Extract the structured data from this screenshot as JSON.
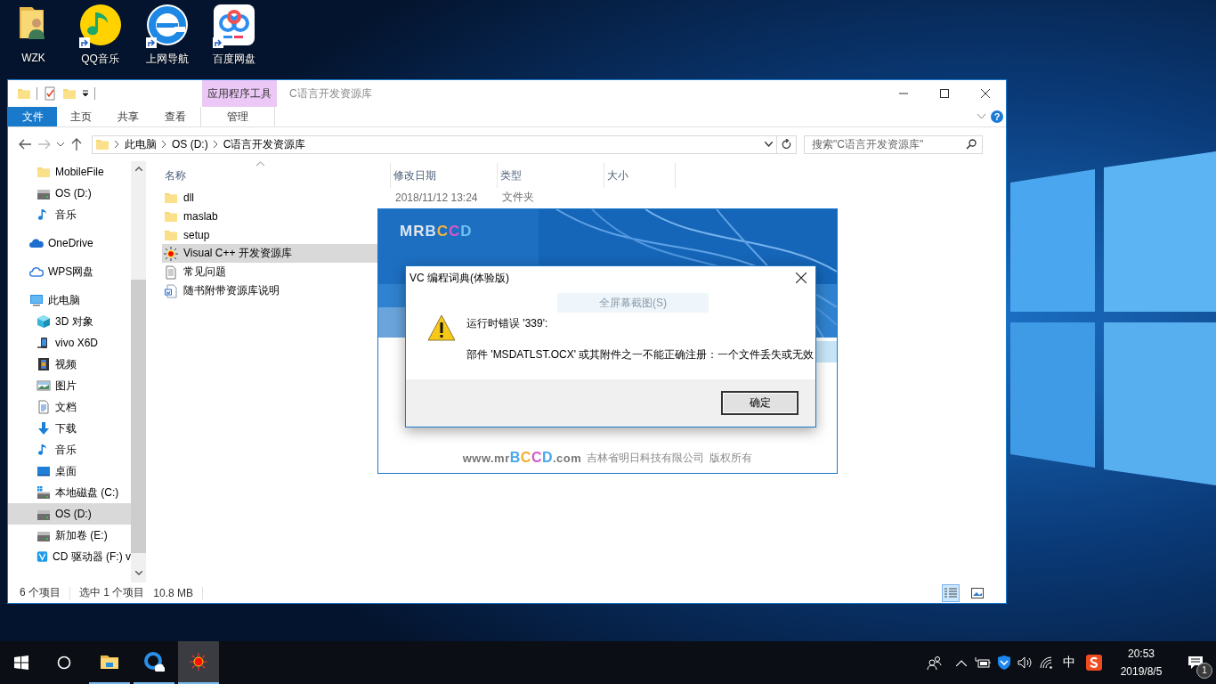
{
  "desktop": {
    "icons": [
      {
        "label": "WZK",
        "kind": "user-folder",
        "shortcut": false
      },
      {
        "label": "QQ音乐",
        "kind": "music-app",
        "shortcut": true
      },
      {
        "label": "上网导航",
        "kind": "browser-app",
        "shortcut": true
      },
      {
        "label": "百度网盘",
        "kind": "cloud-app",
        "shortcut": true
      }
    ]
  },
  "explorer": {
    "context_group": "应用程序工具",
    "title": "C语言开发资源库",
    "file_tab": "文件",
    "tabs": [
      {
        "label": "主页",
        "kind": "standard",
        "selected": false
      },
      {
        "label": "共享",
        "kind": "standard",
        "selected": false
      },
      {
        "label": "查看",
        "kind": "standard",
        "selected": false
      },
      {
        "label": "管理",
        "kind": "context",
        "selected": false
      }
    ],
    "help": "?",
    "address": {
      "crumbs": [
        "此电脑",
        "OS (D:)",
        "C语言开发资源库"
      ]
    },
    "search": {
      "placeholder": "搜索\"C语言开发资源库\""
    },
    "sidebar": {
      "quick_access": [
        {
          "label": "MobileFile",
          "kind": "folder",
          "selected": false
        },
        {
          "label": "OS (D:)",
          "kind": "drive",
          "selected": false
        },
        {
          "label": "音乐",
          "kind": "music",
          "selected": false
        }
      ],
      "items": [
        {
          "label": "OneDrive",
          "kind": "onedrive",
          "selected": false
        },
        {
          "label": "WPS网盘",
          "kind": "wps",
          "selected": false
        },
        {
          "label": "此电脑",
          "kind": "pc",
          "selected": false,
          "children": [
            {
              "label": "3D 对象",
              "kind": "cube",
              "selected": false
            },
            {
              "label": "vivo X6D",
              "kind": "phone",
              "selected": false
            },
            {
              "label": "视频",
              "kind": "video",
              "selected": false
            },
            {
              "label": "图片",
              "kind": "picture",
              "selected": false
            },
            {
              "label": "文档",
              "kind": "doc",
              "selected": false
            },
            {
              "label": "下载",
              "kind": "download",
              "selected": false
            },
            {
              "label": "音乐",
              "kind": "music",
              "selected": false
            },
            {
              "label": "桌面",
              "kind": "desktop",
              "selected": false
            },
            {
              "label": "本地磁盘 (C:)",
              "kind": "localdisk",
              "selected": false
            },
            {
              "label": "OS (D:)",
              "kind": "drive",
              "selected": true
            },
            {
              "label": "新加卷 (E:)",
              "kind": "drive",
              "selected": false
            },
            {
              "label": "CD 驱动器 (F:) v",
              "kind": "cd",
              "selected": false
            }
          ]
        }
      ]
    },
    "columns": [
      "名称",
      "修改日期",
      "类型",
      "大小"
    ],
    "files": [
      {
        "name": "dll",
        "kind": "folder",
        "modified": "2018/11/12 13:24",
        "type": "文件夹",
        "selected": false
      },
      {
        "name": "maslab",
        "kind": "folder",
        "selected": false
      },
      {
        "name": "setup",
        "kind": "folder",
        "selected": false
      },
      {
        "name": "Visual C++ 开发资源库",
        "kind": "app",
        "selected": true
      },
      {
        "name": "常见问题",
        "kind": "text",
        "selected": false
      },
      {
        "name": "随书附带资源库说明",
        "kind": "word",
        "selected": false
      }
    ],
    "status": {
      "count": "6 个项目",
      "selection": "选中 1 个项目",
      "size": "10.8 MB"
    },
    "view_buttons": [
      {
        "kind": "details",
        "selected": true
      },
      {
        "kind": "large-icons",
        "selected": false
      }
    ]
  },
  "splash": {
    "logo": "MRBCCD",
    "site": [
      "www.mr",
      "BCCD",
      ".com"
    ],
    "company": "吉林省明日科技有限公司",
    "rights": "版权所有"
  },
  "dialog": {
    "title": "VC 编程词典(体验版)",
    "ghost_tooltip": "全屏幕截图(S)",
    "lines": [
      "运行时错误 '339':",
      "部件 'MSDATLST.OCX' 或其附件之一不能正确注册：一个文件丢失或无效"
    ],
    "button": "确定"
  },
  "taskbar": {
    "apps": [
      {
        "kind": "explorer",
        "active": false
      },
      {
        "kind": "browser",
        "active": false
      },
      {
        "kind": "sun-app",
        "active": true
      }
    ],
    "tray": {
      "ime": "中",
      "time": "20:53",
      "date": "2019/8/5",
      "notifications": "1"
    }
  }
}
